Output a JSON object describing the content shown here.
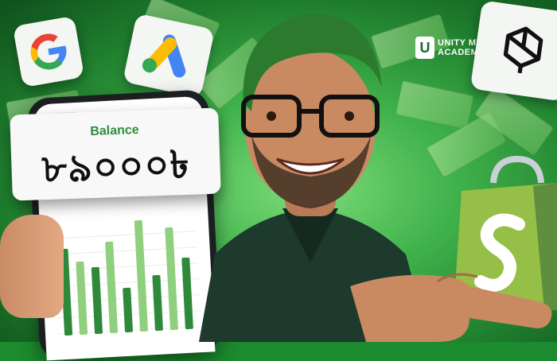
{
  "balance": {
    "label": "Balance",
    "amount": "৮৯০০০৳"
  },
  "academy_logo": {
    "mark": "U",
    "line1": "UNITY MY",
    "line2": "ACADEMY"
  },
  "icons": {
    "google": "google-logo-icon",
    "google_ads": "google-ads-logo-icon",
    "openai": "openai-logo-icon",
    "shopify": "shopify-bag-icon"
  },
  "phone_chart": {
    "type": "bar",
    "values": [
      78,
      66,
      60,
      82,
      40,
      100,
      50,
      92,
      64
    ],
    "colors": [
      "#2e8a3a",
      "#8fd07e"
    ]
  },
  "colors": {
    "background": "#3fb14a",
    "accent_green": "#2f8d3c",
    "shopify_green": "#95bf47"
  }
}
